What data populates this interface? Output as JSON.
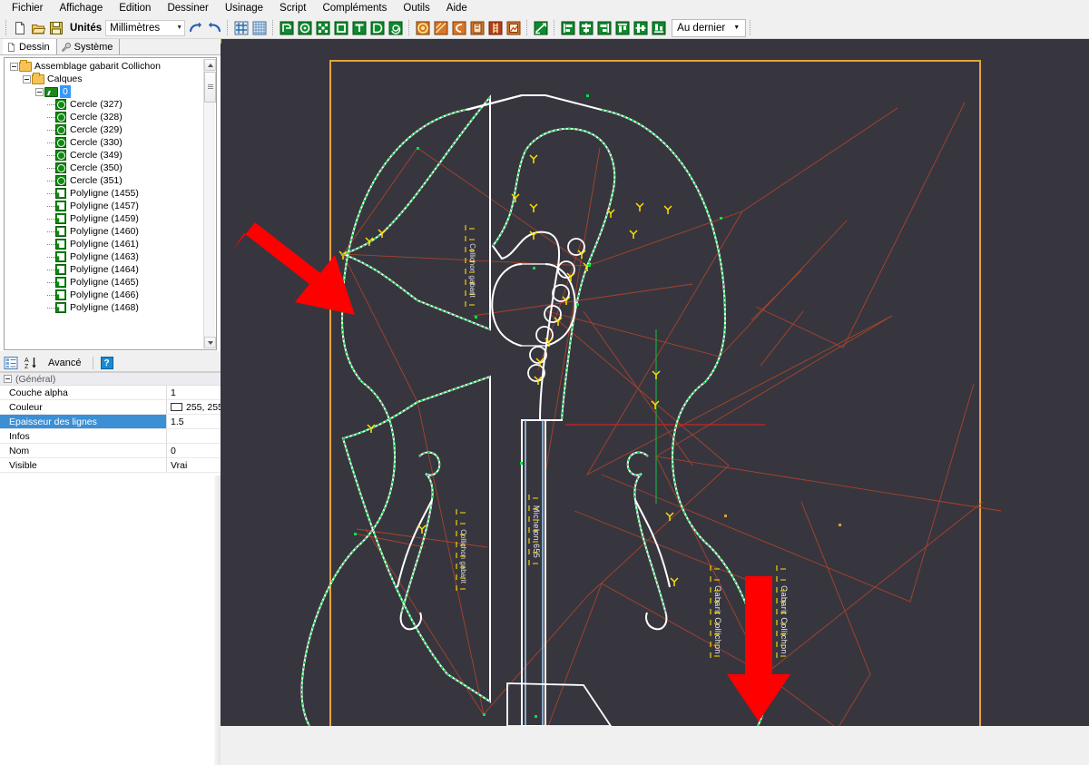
{
  "app": {
    "title": "Assemblage gabarit Collichon",
    "canvas_bg": "#37363f",
    "accent_orange": "#e8a33d",
    "accent_green": "#00d23c",
    "accent_white": "#ffffff",
    "accent_blue": "#9fc7e8",
    "accent_red": "#ff0000",
    "accent_darkred": "#a33a22",
    "accent_yellow": "#ffe000"
  },
  "menubar": {
    "items": [
      {
        "label": "Fichier",
        "name": "menu-fichier"
      },
      {
        "label": "Affichage",
        "name": "menu-affichage"
      },
      {
        "label": "Edition",
        "name": "menu-edition"
      },
      {
        "label": "Dessiner",
        "name": "menu-dessiner"
      },
      {
        "label": "Usinage",
        "name": "menu-usinage"
      },
      {
        "label": "Script",
        "name": "menu-script"
      },
      {
        "label": "Compléments",
        "name": "menu-complements"
      },
      {
        "label": "Outils",
        "name": "menu-outils"
      },
      {
        "label": "Aide",
        "name": "menu-aide"
      }
    ]
  },
  "toolbar": {
    "new_icon": "new-document-icon",
    "open_icon": "open-folder-icon",
    "save_icon": "save-disk-icon",
    "units_label": "Unités",
    "units_value": "Millimètres",
    "undo_icon": "undo-arrow-icon",
    "redo_icon": "redo-arrow-icon",
    "snap_icon": "snap-grid-icon",
    "grid_icon": "show-grid-icon",
    "draw_icons": [
      "polyline-tool-icon",
      "circle-tool-icon",
      "point-cloud-tool-icon",
      "rectangle-tool-icon",
      "text-tool-icon",
      "arc-tool-icon",
      "spiral-tool-icon"
    ],
    "machining_icons": [
      "pocket-machining-icon",
      "engrave-machining-icon",
      "profile-machining-icon",
      "drill-machining-icon",
      "thread-machining-icon",
      "simulation-icon"
    ],
    "transform_icon": "transform-tool-icon",
    "align_icons": [
      "align-left-icon",
      "align-center-horizontal-icon",
      "align-right-icon",
      "align-top-icon",
      "align-center-vertical-icon",
      "align-bottom-icon"
    ],
    "align_target_value": "Au dernier"
  },
  "left_panel": {
    "tabs": [
      {
        "label": "Dessin",
        "icon": "page-icon",
        "active": true,
        "name": "tab-dessin"
      },
      {
        "label": "Système",
        "icon": "wrench-icon",
        "active": false,
        "name": "tab-systeme"
      }
    ],
    "tree": {
      "root": {
        "label": "Assemblage gabarit Collichon",
        "icon": "folder-icon"
      },
      "group": {
        "label": "Calques",
        "icon": "folder-icon"
      },
      "layer": {
        "label": "0",
        "icon": "layer-icon",
        "selected": true
      },
      "items": [
        {
          "label": "Cercle (327)",
          "icon": "circle-object-icon"
        },
        {
          "label": "Cercle (328)",
          "icon": "circle-object-icon"
        },
        {
          "label": "Cercle (329)",
          "icon": "circle-object-icon"
        },
        {
          "label": "Cercle (330)",
          "icon": "circle-object-icon"
        },
        {
          "label": "Cercle (349)",
          "icon": "circle-object-icon"
        },
        {
          "label": "Cercle (350)",
          "icon": "circle-object-icon"
        },
        {
          "label": "Cercle (351)",
          "icon": "circle-object-icon"
        },
        {
          "label": "Polyligne (1455)",
          "icon": "polyline-object-icon"
        },
        {
          "label": "Polyligne (1457)",
          "icon": "polyline-object-icon"
        },
        {
          "label": "Polyligne (1459)",
          "icon": "polyline-object-icon"
        },
        {
          "label": "Polyligne (1460)",
          "icon": "polyline-object-icon"
        },
        {
          "label": "Polyligne (1461)",
          "icon": "polyline-object-icon"
        },
        {
          "label": "Polyligne (1463)",
          "icon": "polyline-object-icon"
        },
        {
          "label": "Polyligne (1464)",
          "icon": "polyline-object-icon"
        },
        {
          "label": "Polyligne (1465)",
          "icon": "polyline-object-icon"
        },
        {
          "label": "Polyligne (1466)",
          "icon": "polyline-object-icon"
        },
        {
          "label": "Polyligne (1468)",
          "icon": "polyline-object-icon"
        }
      ]
    }
  },
  "property_panel": {
    "toolbar": {
      "categorized_icon": "categorized-view-icon",
      "alphabetical_icon": "alphabetical-sort-icon",
      "advanced_label": "Avancé",
      "help_icon": "help-icon",
      "help_glyph": "?"
    },
    "category": "(Général)",
    "rows": [
      {
        "name": "Couche alpha",
        "value": "1",
        "selected": false,
        "swatch": false
      },
      {
        "name": "Couleur",
        "value": "255, 255,",
        "selected": false,
        "swatch": true,
        "swatch_color": "#ffffff"
      },
      {
        "name": "Epaisseur des lignes",
        "value": "1.5",
        "selected": true,
        "swatch": false
      },
      {
        "name": "Infos",
        "value": "",
        "selected": false,
        "swatch": false
      },
      {
        "name": "Nom",
        "value": "0",
        "selected": false,
        "swatch": false
      },
      {
        "name": "Visible",
        "value": "Vrai",
        "selected": false,
        "swatch": false
      }
    ]
  },
  "canvas": {
    "name": "cad-drawing-canvas",
    "description": "Violin / cello template assembly drawing on dark background",
    "annotations": [
      {
        "name": "red-arrow-left",
        "direction": "down-right",
        "points_at": "node on left border"
      },
      {
        "name": "red-arrow-bottom",
        "direction": "down",
        "points_at": "bottom centre node"
      }
    ],
    "vertical_labels": [
      "Michelon 655",
      "Gabarit Collichon",
      "Gabarit Collichon"
    ]
  }
}
